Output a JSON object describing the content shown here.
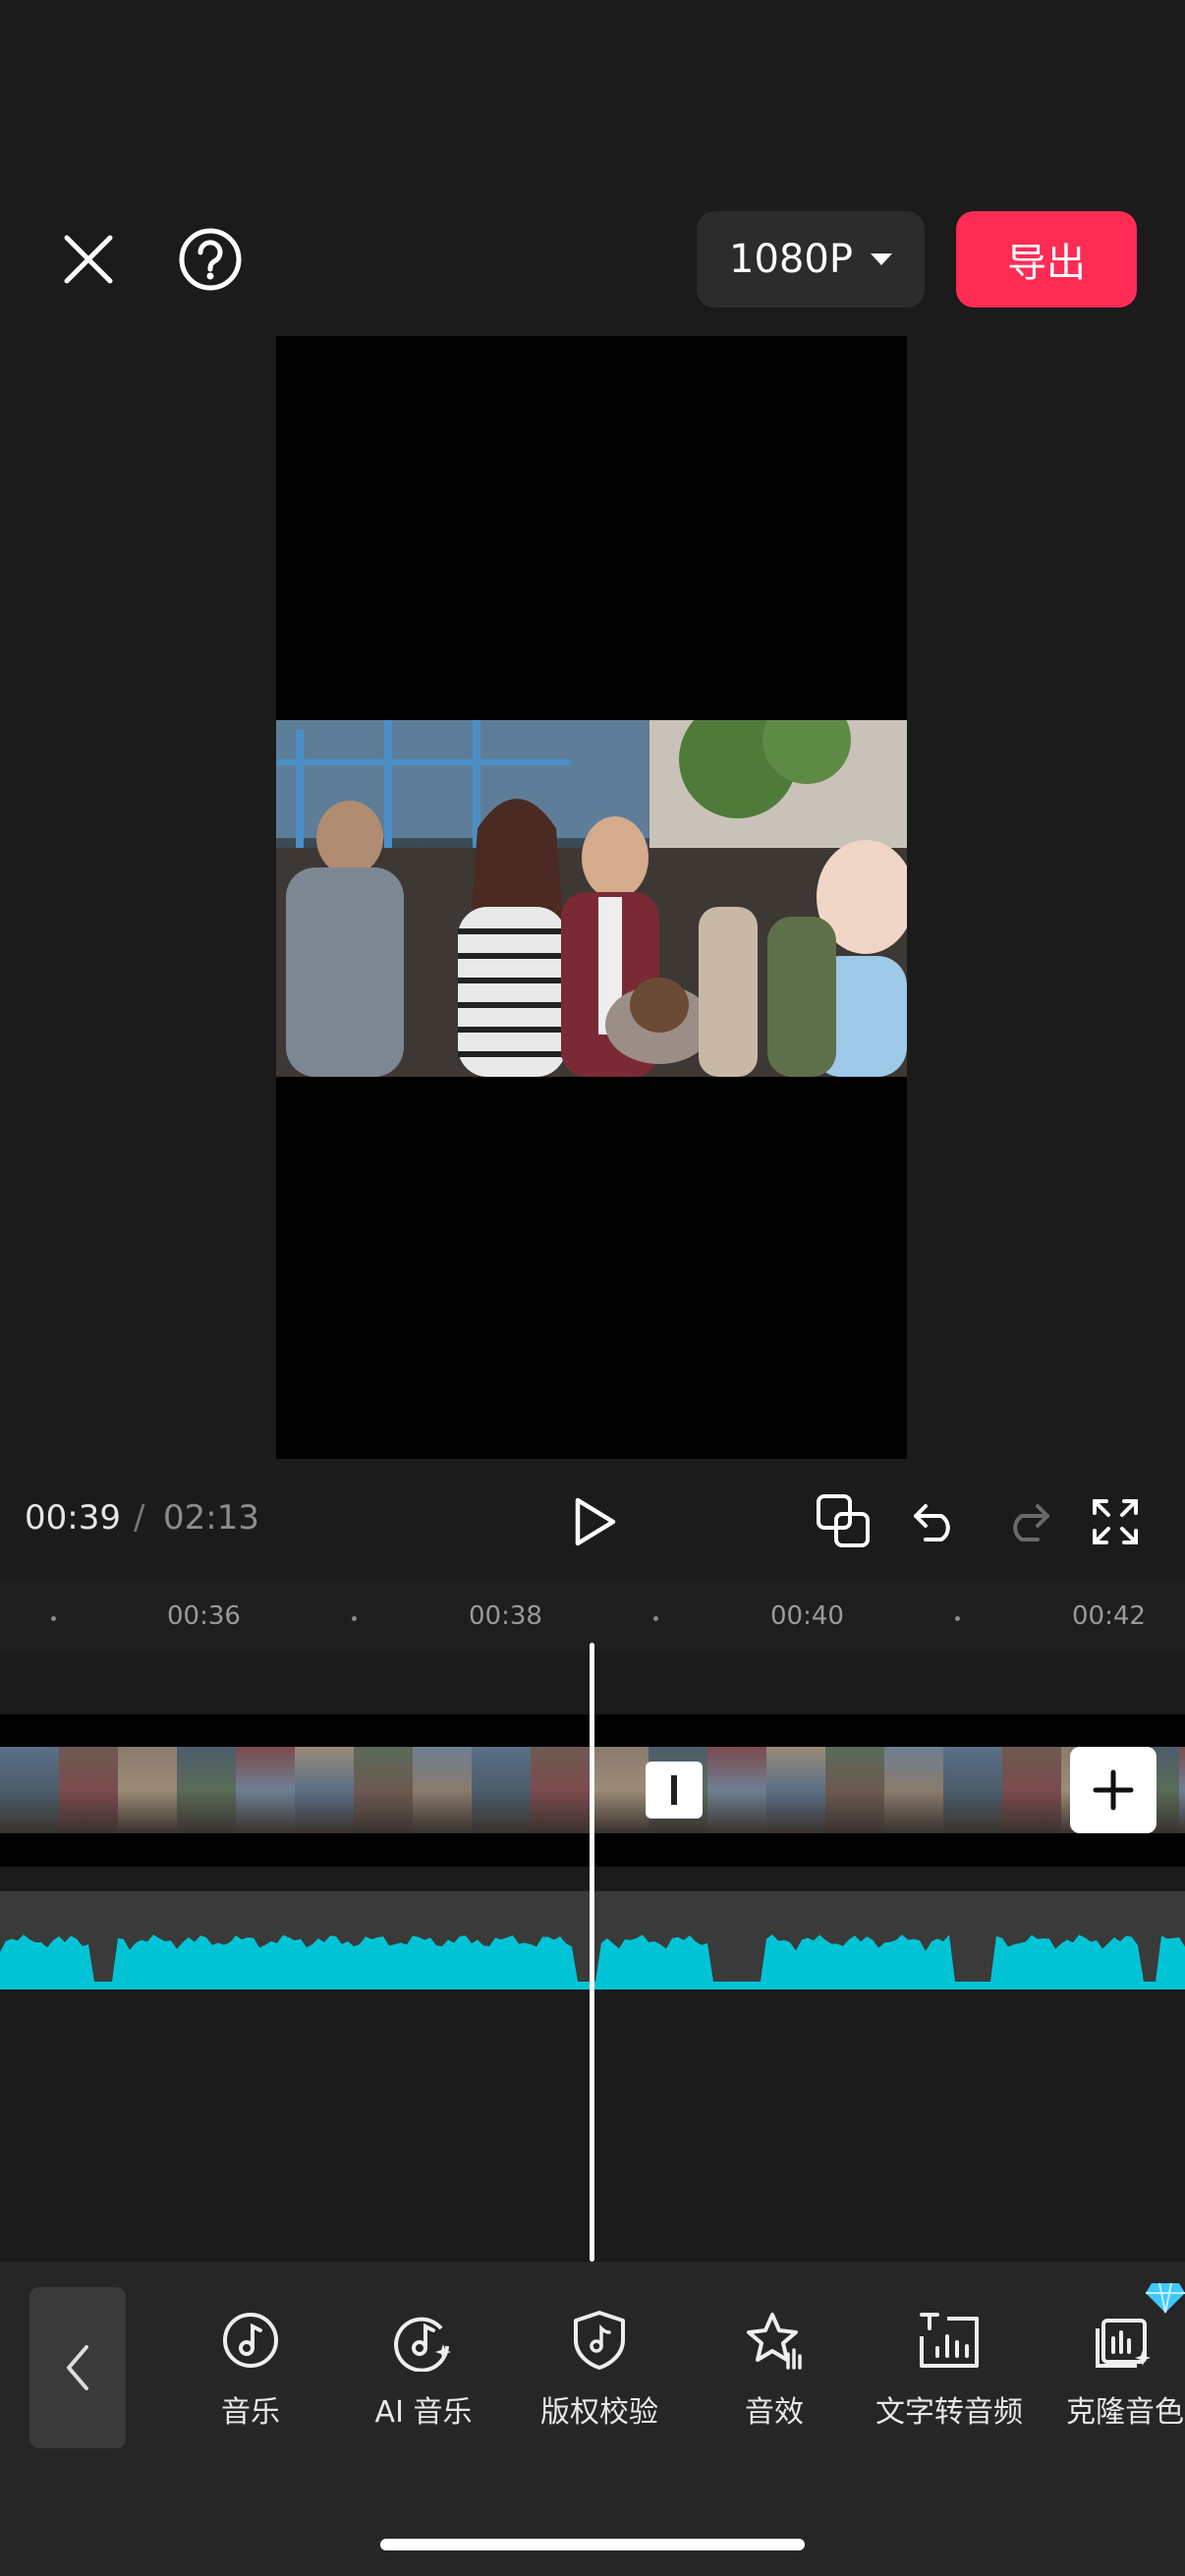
{
  "topbar": {
    "close_icon": "close-icon",
    "help_icon": "help-icon",
    "resolution": "1080P",
    "export_label": "导出",
    "accent": "#fe2c55"
  },
  "player": {
    "current_time": "00:39",
    "separator": "/",
    "total_time": "02:13"
  },
  "controls": {
    "play": "play-icon",
    "keyframe": "overlay-icon",
    "undo": "undo-icon",
    "redo": "redo-icon",
    "fullscreen": "fullscreen-icon"
  },
  "ruler": {
    "ticks": [
      "00:36",
      "00:38",
      "00:40",
      "00:42"
    ]
  },
  "timeline": {
    "waveform_color": "#00c4d6"
  },
  "toolbar": {
    "items": [
      {
        "label": "音乐",
        "icon": "music-note-icon"
      },
      {
        "label": "AI 音乐",
        "icon": "ai-music-icon"
      },
      {
        "label": "版权校验",
        "icon": "copyright-shield-icon"
      },
      {
        "label": "音效",
        "icon": "sound-effect-icon"
      },
      {
        "label": "文字转音频",
        "icon": "text-to-audio-icon"
      },
      {
        "label": "克隆音色",
        "icon": "voice-clone-icon"
      }
    ]
  }
}
